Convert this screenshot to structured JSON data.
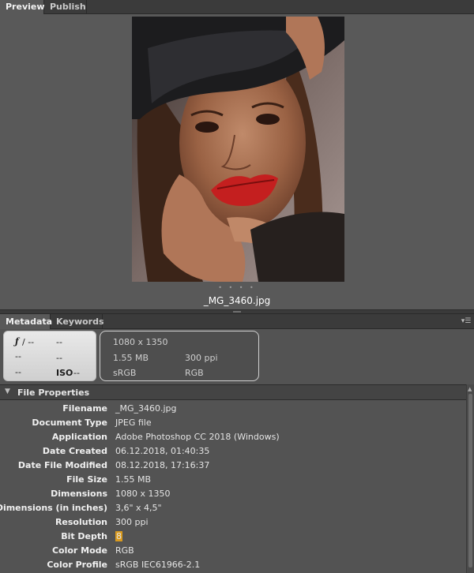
{
  "top_tabs": [
    {
      "label": "Preview",
      "active": true
    },
    {
      "label": "Publish",
      "active": false
    }
  ],
  "preview": {
    "filename": "_MG_3460.jpg",
    "pager_dots": "• • • •"
  },
  "meta_tabs": [
    {
      "label": "Metadata",
      "active": true
    },
    {
      "label": "Keywords",
      "active": false
    }
  ],
  "panel_menu_icon": "panel-menu-icon",
  "camera": {
    "aperture_symbol": "ƒ",
    "aperture": "/ --",
    "shutter": "--",
    "exposure_comp": "--",
    "white_balance": "--",
    "metering": "--",
    "iso_label": "ISO",
    "iso": "--"
  },
  "file_summary": {
    "dimensions": "1080 x 1350",
    "size": "1.55 MB",
    "resolution": "300 ppi",
    "color_profile": "sRGB",
    "color_mode": "RGB"
  },
  "section": {
    "title": "File Properties"
  },
  "properties": [
    {
      "label": "Filename",
      "value": "_MG_3460.jpg"
    },
    {
      "label": "Document Type",
      "value": "JPEG file"
    },
    {
      "label": "Application",
      "value": "Adobe Photoshop CC 2018 (Windows)"
    },
    {
      "label": "Date Created",
      "value": "06.12.2018, 01:40:35"
    },
    {
      "label": "Date File Modified",
      "value": "08.12.2018, 17:16:37"
    },
    {
      "label": "File Size",
      "value": "1.55 MB"
    },
    {
      "label": "Dimensions",
      "value": "1080 x 1350"
    },
    {
      "label": "Dimensions (in inches)",
      "value": "3,6\" x 4,5\""
    },
    {
      "label": "Resolution",
      "value": "300 ppi"
    },
    {
      "label": "Bit Depth",
      "value": "8"
    },
    {
      "label": "Color Mode",
      "value": "RGB"
    },
    {
      "label": "Color Profile",
      "value": "sRGB IEC61966-2.1"
    }
  ],
  "colors": {
    "panel_bg": "#535353",
    "highlight": "#d99a1e"
  }
}
